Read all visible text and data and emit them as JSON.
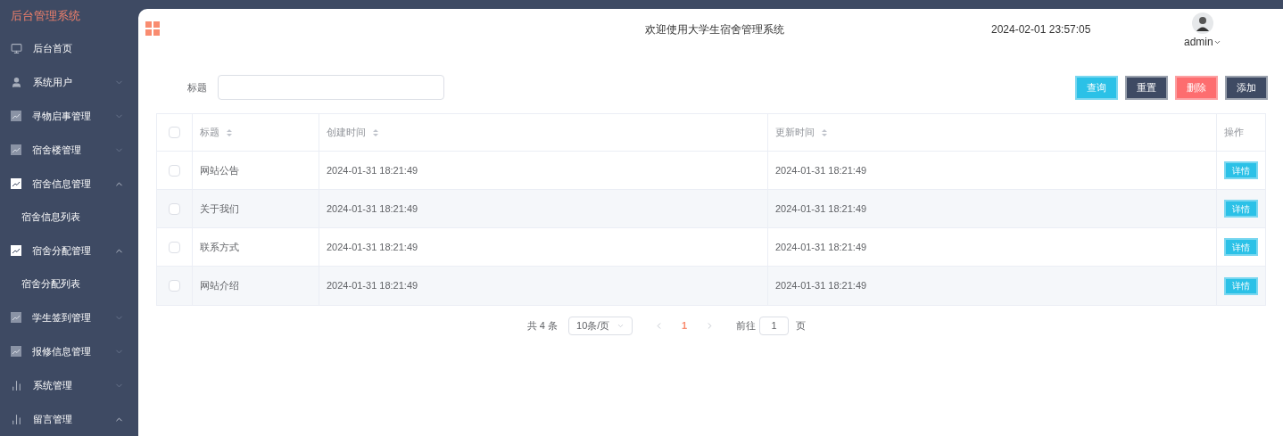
{
  "sidebar": {
    "title": "后台管理系统",
    "items": [
      {
        "label": "后台首页",
        "kind": "monitor"
      },
      {
        "label": "系统用户",
        "kind": "user",
        "expanded": false
      },
      {
        "label": "寻物启事管理",
        "kind": "chart",
        "active": false,
        "expanded": false
      },
      {
        "label": "宿舍楼管理",
        "kind": "chart",
        "active": false,
        "expanded": false
      },
      {
        "label": "宿舍信息管理",
        "kind": "chart",
        "active": true,
        "expanded": true,
        "children": [
          {
            "label": "宿舍信息列表"
          }
        ]
      },
      {
        "label": "宿舍分配管理",
        "kind": "chart",
        "active": true,
        "expanded": true,
        "children": [
          {
            "label": "宿舍分配列表"
          }
        ]
      },
      {
        "label": "学生签到管理",
        "kind": "chart",
        "active": false,
        "expanded": false
      },
      {
        "label": "报修信息管理",
        "kind": "chart",
        "active": false,
        "expanded": false
      },
      {
        "label": "系统管理",
        "kind": "bars",
        "expanded": false
      },
      {
        "label": "留言管理",
        "kind": "bars",
        "expanded": true
      }
    ]
  },
  "header": {
    "title": "欢迎使用大学生宿舍管理系统",
    "datetime": "2024-02-01 23:57:05",
    "user": "admin"
  },
  "search": {
    "label": "标题",
    "buttons": [
      {
        "label": "查询",
        "kind": "primary"
      },
      {
        "label": "重置",
        "kind": "dark"
      },
      {
        "label": "删除",
        "kind": "danger"
      },
      {
        "label": "添加",
        "kind": "dark"
      }
    ]
  },
  "table": {
    "all_checked": false,
    "columns": [
      {
        "label": "标题",
        "sortable": true
      },
      {
        "label": "创建时间",
        "sortable": true
      },
      {
        "label": "更新时间",
        "sortable": true
      },
      {
        "label": "操作",
        "sortable": false
      }
    ],
    "rows": [
      {
        "title": "网站公告",
        "created": "2024-01-31 18:21:49",
        "updated": "2024-01-31 18:21:49",
        "action": "详情",
        "checked": false
      },
      {
        "title": "关于我们",
        "created": "2024-01-31 18:21:49",
        "updated": "2024-01-31 18:21:49",
        "action": "详情",
        "checked": false
      },
      {
        "title": "联系方式",
        "created": "2024-01-31 18:21:49",
        "updated": "2024-01-31 18:21:49",
        "action": "详情",
        "checked": false
      },
      {
        "title": "网站介绍",
        "created": "2024-01-31 18:21:49",
        "updated": "2024-01-31 18:21:49",
        "action": "详情",
        "checked": false
      }
    ]
  },
  "pagination": {
    "total": "共 4 条",
    "page_size": "10条/页",
    "pages": [
      {
        "label": "1",
        "selected": true
      }
    ],
    "goto_label": "前往",
    "goto_value": "1",
    "goto_suffix": "页"
  }
}
